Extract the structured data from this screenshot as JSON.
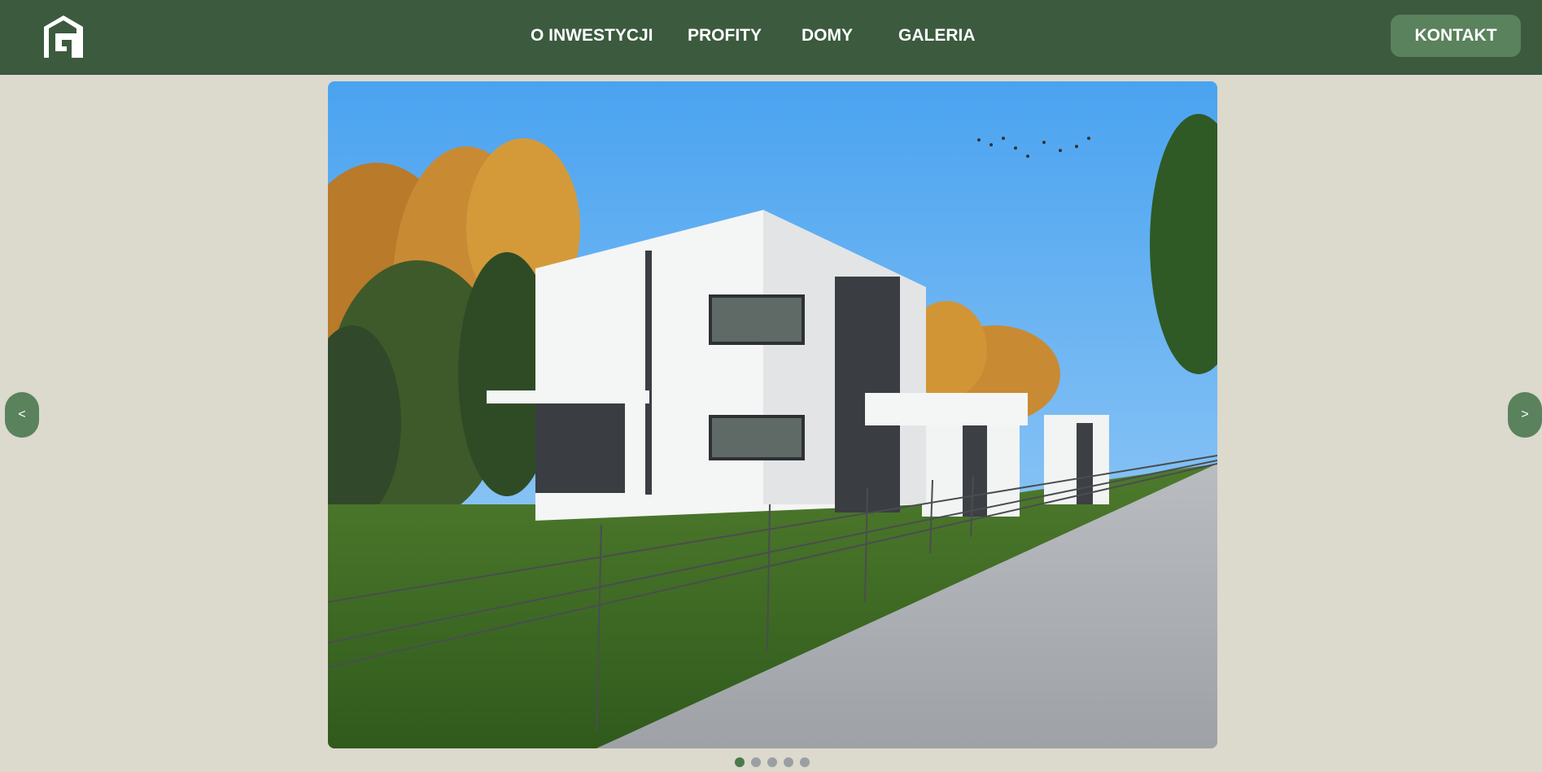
{
  "header": {
    "logo_icon": "house-g-logo-icon",
    "nav": [
      {
        "label": "O INWESTYCJI"
      },
      {
        "label": "PROFITY"
      },
      {
        "label": "DOMY"
      },
      {
        "label": "GALERIA"
      }
    ],
    "contact_label": "KONTAKT"
  },
  "slider": {
    "prev_label": "<",
    "next_label": ">",
    "slides_total": 5,
    "active_index": 1
  },
  "colors": {
    "header_bg": "#3b5a3e",
    "accent": "#5a825c",
    "page_bg": "#dcd9cd",
    "dot_active": "#4a7a4c",
    "dot_inactive": "#9aa0a2"
  }
}
